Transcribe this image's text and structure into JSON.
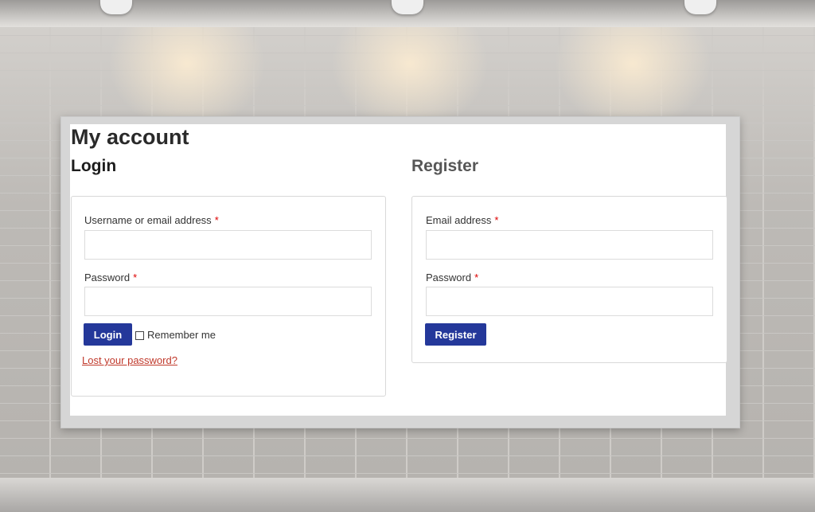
{
  "page": {
    "title": "My account"
  },
  "login": {
    "heading": "Login",
    "username_label": "Username or email address",
    "username_value": "",
    "password_label": "Password",
    "password_value": "",
    "required_mark": "*",
    "submit_label": "Login",
    "remember_label": "Remember me",
    "lost_password_link": "Lost your password?"
  },
  "register": {
    "heading": "Register",
    "email_label": "Email address",
    "email_value": "",
    "password_label": "Password",
    "password_value": "",
    "required_mark": "*",
    "submit_label": "Register"
  },
  "colors": {
    "button": "#24389a",
    "required": "#dd0000",
    "link": "#c0392b"
  }
}
